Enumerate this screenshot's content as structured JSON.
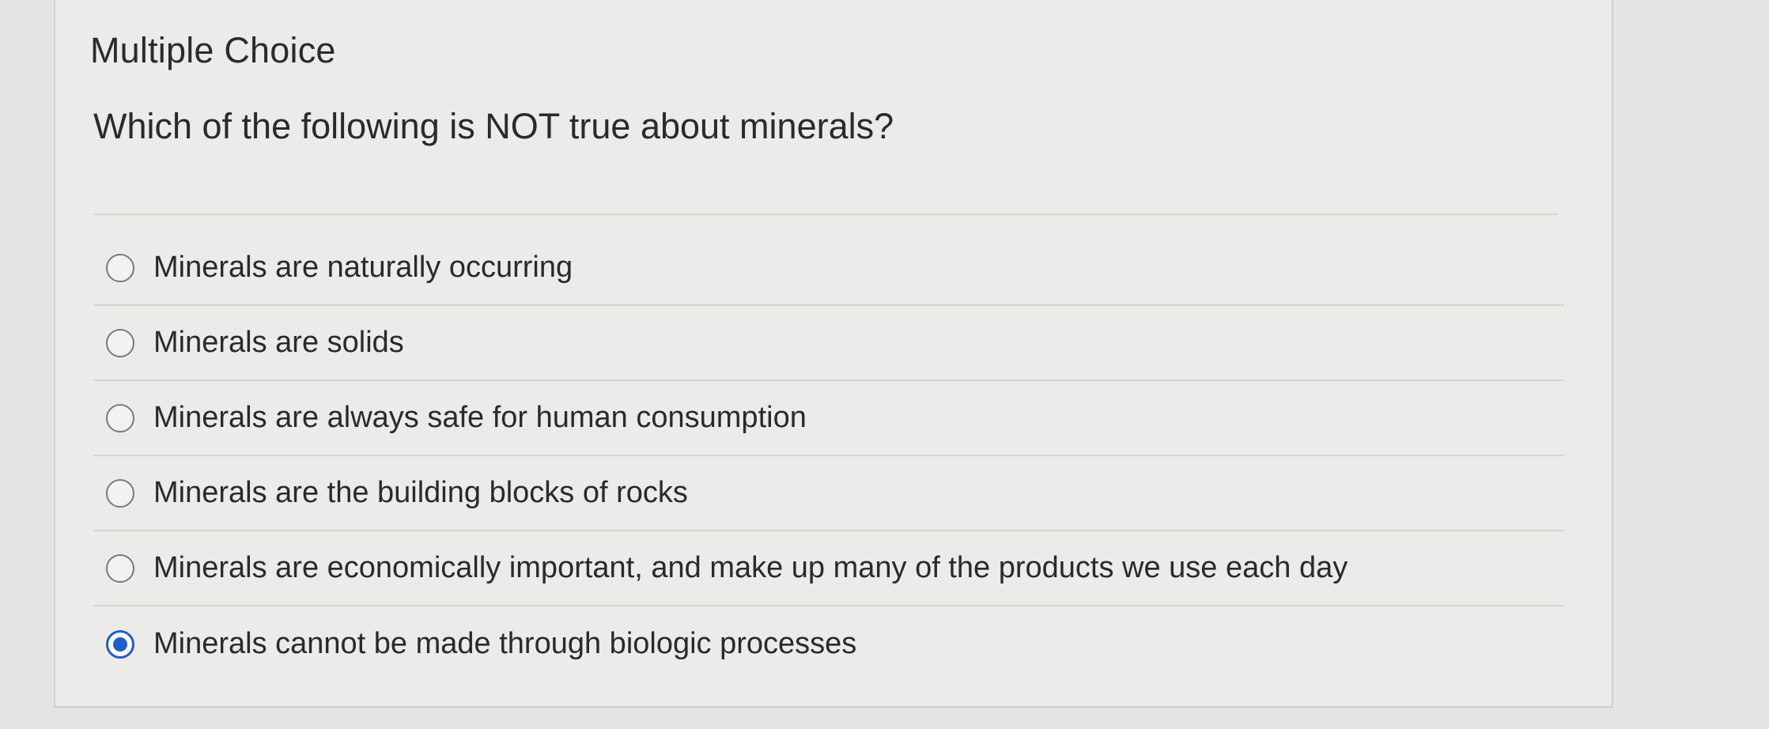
{
  "header": {
    "title": "Multiple Choice"
  },
  "question": {
    "text": "Which of the following is NOT true about minerals?"
  },
  "options": [
    {
      "label": "Minerals are naturally occurring",
      "selected": false
    },
    {
      "label": "Minerals are solids",
      "selected": false
    },
    {
      "label": "Minerals are always safe for human consumption",
      "selected": false
    },
    {
      "label": "Minerals are the building blocks of rocks",
      "selected": false
    },
    {
      "label": "Minerals are economically important, and make up many of the products we use each day",
      "selected": false
    },
    {
      "label": "Minerals cannot be made through biologic processes",
      "selected": true
    }
  ],
  "colors": {
    "accent": "#1f5ec9",
    "page_background": "#e4e4e2",
    "card_background": "#ecebe9"
  }
}
